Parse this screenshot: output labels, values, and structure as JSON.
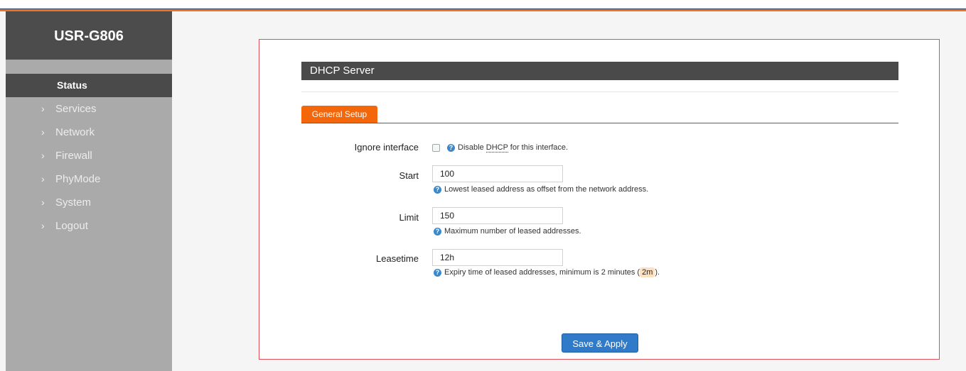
{
  "brand": "USR-G806",
  "sidebar": {
    "items": [
      {
        "label": "Status",
        "active": true
      },
      {
        "label": "Services"
      },
      {
        "label": "Network"
      },
      {
        "label": "Firewall"
      },
      {
        "label": "PhyMode"
      },
      {
        "label": "System"
      },
      {
        "label": "Logout"
      }
    ]
  },
  "section": {
    "title": "DHCP Server"
  },
  "tabs": [
    {
      "label": "General Setup",
      "active": true
    }
  ],
  "form": {
    "ignore_interface": {
      "label": "Ignore interface",
      "checked": false,
      "hint_prefix": "Disable ",
      "hint_dhcp": "DHCP",
      "hint_suffix": " for this interface."
    },
    "start": {
      "label": "Start",
      "value": "100",
      "hint": "Lowest leased address as offset from the network address."
    },
    "limit": {
      "label": "Limit",
      "value": "150",
      "hint": "Maximum number of leased addresses."
    },
    "leasetime": {
      "label": "Leasetime",
      "value": "12h",
      "hint_prefix": "Expiry time of leased addresses, minimum is 2 minutes (",
      "hint_badge": "2m",
      "hint_suffix": ")."
    }
  },
  "actions": {
    "save_apply": "Save & Apply"
  },
  "colors": {
    "accent": "#f4660a",
    "sidebar_bg": "#aaaaaa",
    "header_bg": "#4a4a4a",
    "button": "#2f7bc9",
    "frame_border": "#e0505a"
  }
}
